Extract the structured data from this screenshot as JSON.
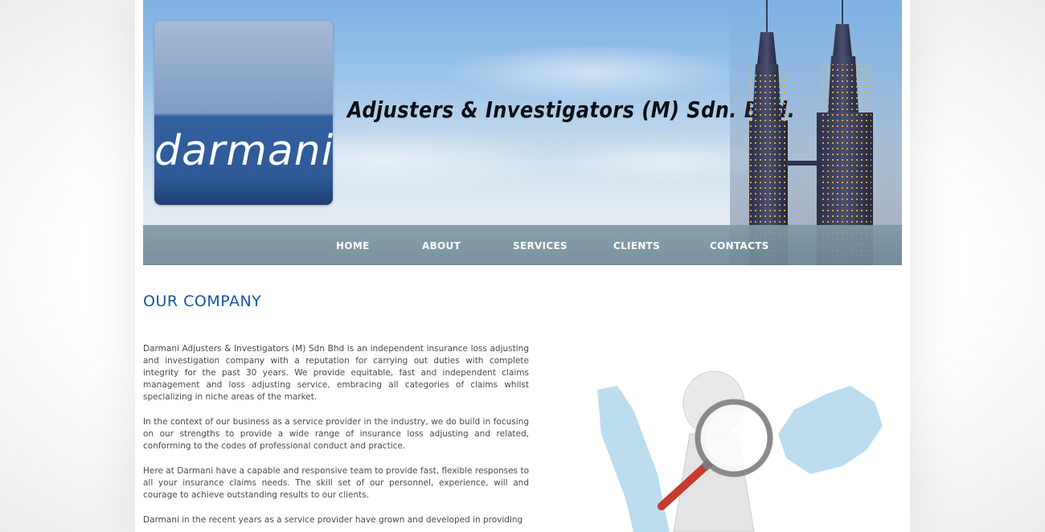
{
  "header": {
    "logo_text": "darmani",
    "company_name": "Adjusters & Investigators (M) Sdn. Bhd."
  },
  "nav": {
    "items": [
      "HOME",
      "ABOUT",
      "SERVICES",
      "CLIENTS",
      "CONTACTS"
    ]
  },
  "content": {
    "heading": "OUR COMPANY",
    "paragraphs": [
      "Darmani Adjusters & Investigators (M) Sdn Bhd is an independent insurance loss adjusting and investigation company with a reputation for carrying out duties with complete integrity for the past 30 years. We provide equitable, fast and independent claims management and loss adjusting service, embracing all categories of claims whilst specializing in niche areas of the market.",
      "In the context of our business as a service provider in the industry, we do build in focusing on our strengths to provide a wide range of insurance loss adjusting and related, conforming to the codes of professional conduct and practice.",
      "Here at Darmani have a capable and responsive team to provide fast, flexible responses to all your insurance claims needs. The skill set of our personnel, experience, will and courage to achieve outstanding results to our clients.",
      "Darmani in the recent years as a service provider have grown and developed in providing"
    ]
  },
  "colors": {
    "heading": "#1a55a6",
    "navbar": "#7e9aa5",
    "logo_blue": "#2e5a97"
  }
}
